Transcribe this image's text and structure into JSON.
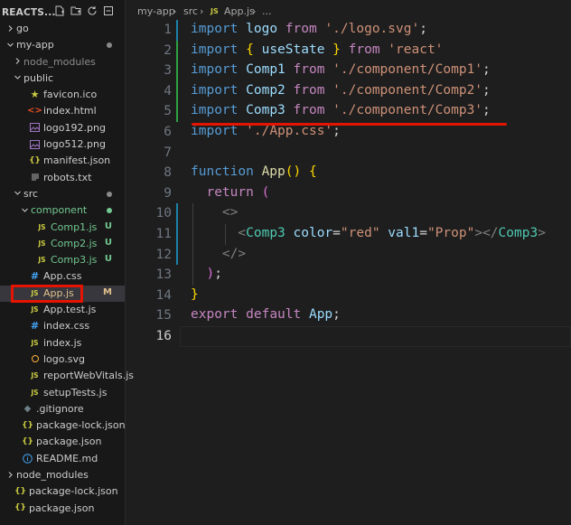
{
  "explorer": {
    "title": "REACTS...",
    "items": [
      {
        "label": "go",
        "indent": 0,
        "chev": "right",
        "icon": "none",
        "color": "#cccccc"
      },
      {
        "label": "my-app",
        "indent": 0,
        "chev": "down",
        "icon": "none",
        "color": "#cccccc",
        "dot": true
      },
      {
        "label": "node_modules",
        "indent": 1,
        "chev": "right",
        "icon": "none",
        "color": "#8b8b8b",
        "dim": true
      },
      {
        "label": "public",
        "indent": 1,
        "chev": "down",
        "icon": "none",
        "color": "#cccccc"
      },
      {
        "label": "favicon.ico",
        "indent": 2,
        "icon": "star",
        "color": "#cccccc"
      },
      {
        "label": "index.html",
        "indent": 2,
        "icon": "html",
        "color": "#cccccc"
      },
      {
        "label": "logo192.png",
        "indent": 2,
        "icon": "image",
        "color": "#cccccc"
      },
      {
        "label": "logo512.png",
        "indent": 2,
        "icon": "image",
        "color": "#cccccc"
      },
      {
        "label": "manifest.json",
        "indent": 2,
        "icon": "json",
        "color": "#cccccc"
      },
      {
        "label": "robots.txt",
        "indent": 2,
        "icon": "text",
        "color": "#cccccc"
      },
      {
        "label": "src",
        "indent": 1,
        "chev": "down",
        "icon": "none",
        "color": "#cccccc",
        "dot": true
      },
      {
        "label": "component",
        "indent": 2,
        "chev": "down",
        "icon": "none",
        "color": "#73c991",
        "dot": true,
        "dotColor": "#73c991"
      },
      {
        "label": "Comp1.js",
        "indent": 3,
        "icon": "js",
        "color": "#73c991",
        "badge": "U"
      },
      {
        "label": "Comp2.js",
        "indent": 3,
        "icon": "js",
        "color": "#73c991",
        "badge": "U"
      },
      {
        "label": "Comp3.js",
        "indent": 3,
        "icon": "js",
        "color": "#73c991",
        "badge": "U"
      },
      {
        "label": "App.css",
        "indent": 2,
        "icon": "css",
        "color": "#cccccc"
      },
      {
        "label": "App.js",
        "indent": 2,
        "icon": "js",
        "color": "#e2c08d",
        "badge": "M",
        "selected": true
      },
      {
        "label": "App.test.js",
        "indent": 2,
        "icon": "js",
        "color": "#cccccc"
      },
      {
        "label": "index.css",
        "indent": 2,
        "icon": "css",
        "color": "#cccccc"
      },
      {
        "label": "index.js",
        "indent": 2,
        "icon": "js",
        "color": "#cccccc"
      },
      {
        "label": "logo.svg",
        "indent": 2,
        "icon": "svg",
        "color": "#cccccc"
      },
      {
        "label": "reportWebVitals.js",
        "indent": 2,
        "icon": "js",
        "color": "#cccccc"
      },
      {
        "label": "setupTests.js",
        "indent": 2,
        "icon": "js",
        "color": "#cccccc"
      },
      {
        "label": ".gitignore",
        "indent": 1,
        "icon": "git",
        "color": "#cccccc"
      },
      {
        "label": "package-lock.json",
        "indent": 1,
        "icon": "json",
        "color": "#cccccc"
      },
      {
        "label": "package.json",
        "indent": 1,
        "icon": "json",
        "color": "#cccccc"
      },
      {
        "label": "README.md",
        "indent": 1,
        "icon": "info",
        "color": "#cccccc"
      },
      {
        "label": "node_modules",
        "indent": 0,
        "chev": "right",
        "icon": "none",
        "color": "#cccccc"
      },
      {
        "label": "package-lock.json",
        "indent": 0,
        "icon": "json",
        "color": "#cccccc"
      },
      {
        "label": "package.json",
        "indent": 0,
        "icon": "json",
        "color": "#cccccc"
      }
    ]
  },
  "breadcrumb": {
    "folder1": "my-app",
    "folder2": "src",
    "file_badge": "JS",
    "file": "App.js",
    "more": "..."
  },
  "code": {
    "lines": [
      {
        "n": "1",
        "mark": "mod",
        "html": [
          [
            "k",
            "import"
          ],
          [
            "src",
            " "
          ],
          [
            "v",
            "logo"
          ],
          [
            "src",
            " "
          ],
          [
            "kc",
            "from"
          ],
          [
            "src",
            " "
          ],
          [
            "s",
            "'./logo.svg'"
          ],
          [
            "src",
            ";"
          ]
        ]
      },
      {
        "n": "2",
        "mark": "add",
        "html": [
          [
            "k",
            "import"
          ],
          [
            "src",
            " "
          ],
          [
            "b1",
            "{"
          ],
          [
            "src",
            " "
          ],
          [
            "v",
            "useState"
          ],
          [
            "src",
            " "
          ],
          [
            "b1",
            "}"
          ],
          [
            "src",
            " "
          ],
          [
            "kc",
            "from"
          ],
          [
            "src",
            " "
          ],
          [
            "s",
            "'react'"
          ]
        ]
      },
      {
        "n": "3",
        "mark": "add",
        "html": [
          [
            "k",
            "import"
          ],
          [
            "src",
            " "
          ],
          [
            "v",
            "Comp1"
          ],
          [
            "src",
            " "
          ],
          [
            "kc",
            "from"
          ],
          [
            "src",
            " "
          ],
          [
            "s",
            "'./component/Comp1'"
          ],
          [
            "src",
            ";"
          ]
        ]
      },
      {
        "n": "4",
        "mark": "add",
        "html": [
          [
            "k",
            "import"
          ],
          [
            "src",
            " "
          ],
          [
            "v",
            "Comp2"
          ],
          [
            "src",
            " "
          ],
          [
            "kc",
            "from"
          ],
          [
            "src",
            " "
          ],
          [
            "s",
            "'./component/Comp2'"
          ],
          [
            "src",
            ";"
          ]
        ]
      },
      {
        "n": "5",
        "mark": "add",
        "html": [
          [
            "k",
            "import"
          ],
          [
            "src",
            " "
          ],
          [
            "v",
            "Comp3"
          ],
          [
            "src",
            " "
          ],
          [
            "kc",
            "from"
          ],
          [
            "src",
            " "
          ],
          [
            "s",
            "'./component/Comp3'"
          ],
          [
            "src",
            ";"
          ]
        ]
      },
      {
        "n": "6",
        "mark": "",
        "html": [
          [
            "k",
            "import"
          ],
          [
            "src",
            " "
          ],
          [
            "s",
            "'./App.css'"
          ],
          [
            "src",
            ";"
          ]
        ]
      },
      {
        "n": "7",
        "mark": "",
        "html": []
      },
      {
        "n": "8",
        "mark": "",
        "html": [
          [
            "k",
            "function"
          ],
          [
            "src",
            " "
          ],
          [
            "f",
            "App"
          ],
          [
            "b1",
            "()"
          ],
          [
            "src",
            " "
          ],
          [
            "b1",
            "{"
          ]
        ]
      },
      {
        "n": "9",
        "mark": "",
        "html": [
          [
            "src",
            "  "
          ],
          [
            "kc",
            "return"
          ],
          [
            "src",
            " "
          ],
          [
            "b2",
            "("
          ]
        ]
      },
      {
        "n": "10",
        "mark": "mod",
        "html": [
          [
            "src",
            "    "
          ],
          [
            "p",
            "<>"
          ]
        ]
      },
      {
        "n": "11",
        "mark": "mod",
        "html": [
          [
            "src",
            "      "
          ],
          [
            "p",
            "<"
          ],
          [
            "t",
            "Comp3"
          ],
          [
            "src",
            " "
          ],
          [
            "v",
            "color"
          ],
          [
            "src",
            "="
          ],
          [
            "s",
            "\"red\""
          ],
          [
            "src",
            " "
          ],
          [
            "v",
            "val1"
          ],
          [
            "src",
            "="
          ],
          [
            "s",
            "\"Prop\""
          ],
          [
            "p",
            "></"
          ],
          [
            "t",
            "Comp3"
          ],
          [
            "p",
            ">"
          ]
        ]
      },
      {
        "n": "12",
        "mark": "mod",
        "html": [
          [
            "src",
            "    "
          ],
          [
            "p",
            "</>"
          ]
        ]
      },
      {
        "n": "13",
        "mark": "",
        "html": [
          [
            "src",
            "  "
          ],
          [
            "b2",
            ")"
          ],
          [
            "src",
            ";"
          ]
        ]
      },
      {
        "n": "14",
        "mark": "",
        "html": [
          [
            "b1",
            "}"
          ]
        ]
      },
      {
        "n": "15",
        "mark": "",
        "html": [
          [
            "kc",
            "export"
          ],
          [
            "src",
            " "
          ],
          [
            "kc",
            "default"
          ],
          [
            "src",
            " "
          ],
          [
            "v",
            "App"
          ],
          [
            "src",
            ";"
          ]
        ]
      },
      {
        "n": "16",
        "mark": "",
        "html": [],
        "current": true
      }
    ]
  },
  "colors": {
    "annotation_red": "#e51400",
    "untracked_green": "#73c991",
    "modified_yellow": "#e2c08d"
  }
}
